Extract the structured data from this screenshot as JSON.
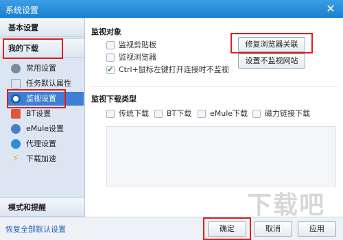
{
  "window": {
    "title": "系统设置",
    "close_glyph": "✕"
  },
  "sidebar": {
    "basic_settings": "基本设置",
    "my_downloads": "我的下载",
    "items": [
      {
        "label": "常用设置",
        "icon": "gear-icon",
        "color": "#7a8a9a"
      },
      {
        "label": "任务默认属性",
        "icon": "document-icon",
        "color": "#8aa0b8"
      },
      {
        "label": "监视设置",
        "icon": "eye-icon",
        "color": "#ffffff",
        "active": true
      },
      {
        "label": "BT设置",
        "icon": "bt-icon",
        "color": "#e0553a"
      },
      {
        "label": "eMule设置",
        "icon": "emule-icon",
        "color": "#4a7cc9"
      },
      {
        "label": "代理设置",
        "icon": "globe-icon",
        "color": "#2f8bd8"
      },
      {
        "label": "下载加速",
        "icon": "lightning-icon",
        "color": "#f0a020"
      }
    ],
    "mode_and_tips": "模式和提醒"
  },
  "monitor_objects": {
    "title": "监视对象",
    "options": [
      {
        "label": "监视剪贴板",
        "checked": false
      },
      {
        "label": "监视浏览器",
        "checked": false
      },
      {
        "label": "Ctrl+鼠标左键打开连接时不监视",
        "checked": true
      }
    ],
    "repair_button": "修复浏览器关联",
    "exclude_sites_button": "设置不监视网站"
  },
  "monitor_download_types": {
    "title": "监视下载类型",
    "options": [
      {
        "label": "传统下载",
        "checked": false
      },
      {
        "label": "BT下载",
        "checked": false
      },
      {
        "label": "eMule下载",
        "checked": false
      },
      {
        "label": "磁力链接下载",
        "checked": false
      }
    ]
  },
  "footer": {
    "restore_defaults": "恢复全部默认设置",
    "ok": "确定",
    "cancel": "取消",
    "apply": "应用"
  },
  "watermark": "下载吧",
  "colors": {
    "titlebar": "#1b7fd0",
    "sidebar_active": "#3e7ed3",
    "highlight": "#e31c1c"
  }
}
